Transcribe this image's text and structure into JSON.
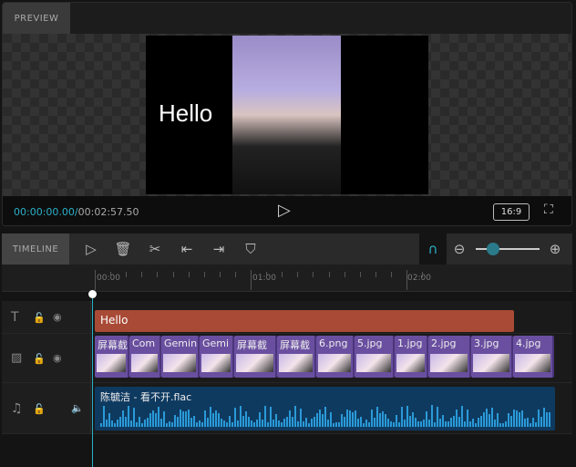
{
  "preview": {
    "tab": "PREVIEW",
    "overlay_text": "Hello",
    "current_time": "00:00:00.00",
    "separator": "/",
    "total_time": "00:02:57.50",
    "aspect_ratio": "16:9"
  },
  "timeline": {
    "tab": "TIMELINE",
    "zoom_level_percent": 10,
    "ruler": [
      "00:00",
      "01:00",
      "02:00"
    ],
    "text_clip": "Hello",
    "image_clips": [
      "屏幕截",
      "Com",
      "Gemin",
      "Gemi",
      "屏幕截",
      "屏幕截",
      "6.png",
      "5.jpg",
      "1.jpg",
      "2.jpg",
      "3.jpg",
      "4.jpg"
    ],
    "audio_clip": "陈毓洁 - 看不开.flac"
  },
  "colors": {
    "accent": "#2ab0c8",
    "text_clip": "#a84a35",
    "image_clip": "#6a4fa0",
    "audio_clip": "#0f3a60"
  }
}
